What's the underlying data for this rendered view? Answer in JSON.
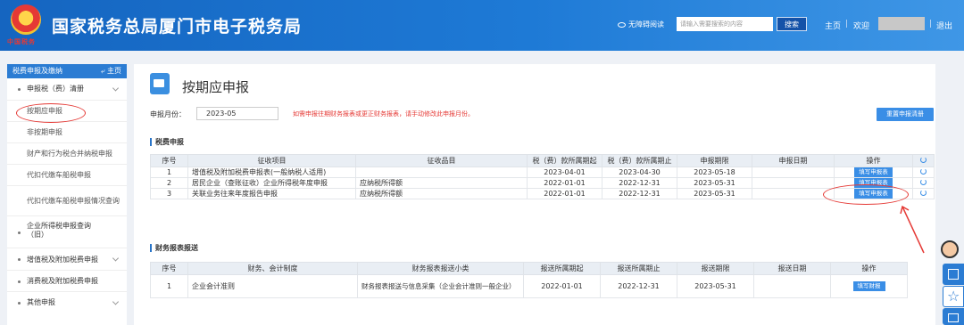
{
  "header": {
    "seal_text": "中国税务",
    "title": "国家税务总局厦门市电子税务局",
    "accessibility": "无障碍阅读",
    "search_placeholder": "请输入需要搜索的内容",
    "search_button": "搜索",
    "home": "主页",
    "welcome": "欢迎",
    "logout": "退出",
    "brand_color": "#1e7ad6"
  },
  "sidebar": {
    "title": "税费申报及缴纳",
    "home": "主页",
    "groups": [
      {
        "label": "申报税（费）清册"
      },
      {
        "label": "企业所得税申报查询（旧）"
      },
      {
        "label": "增值税及附加税费申报"
      },
      {
        "label": "消费税及附加税费申报"
      },
      {
        "label": "其他申报"
      }
    ],
    "items": [
      {
        "label": "按期应申报"
      },
      {
        "label": "非按期申报"
      },
      {
        "label": "财产和行为税合并纳税申报"
      },
      {
        "label": "代扣代缴车船税申报"
      },
      {
        "label": "代扣代缴车船税申报情况查询"
      }
    ]
  },
  "main": {
    "title": "按期应申报",
    "month_label": "申报月份：",
    "month_value": "2023-05",
    "warning": "如需申报往期财务报表或更正财务报表，请手动修改此申报月份。",
    "reset_button": "重置申报清册",
    "tax_section": "税费申报",
    "tax_headers": [
      "序号",
      "征收项目",
      "征收品目",
      "税（费）款所属期起",
      "税（费）款所属期止",
      "申报期限",
      "申报日期",
      "操作"
    ],
    "tax_rows": [
      {
        "no": "1",
        "item": "增值税及附加税费申报表(一般纳税人适用)",
        "subitem": "",
        "start": "2023-04-01",
        "end": "2023-04-30",
        "deadline": "2023-05-18",
        "date": "",
        "action": "填写申报表"
      },
      {
        "no": "2",
        "item": "居民企业（查账征收）企业所得税年度申报",
        "subitem": "应纳税所得额",
        "start": "2022-01-01",
        "end": "2022-12-31",
        "deadline": "2023-05-31",
        "date": "",
        "action": "填写申报表"
      },
      {
        "no": "3",
        "item": "关联业务往来年度报告申报",
        "subitem": "应纳税所得额",
        "start": "2022-01-01",
        "end": "2022-12-31",
        "deadline": "2023-05-31",
        "date": "",
        "action": "填写申报表"
      }
    ],
    "fin_section": "财务报表报送",
    "fin_headers": [
      "序号",
      "财务、会计制度",
      "财务报表报送小类",
      "报送所属期起",
      "报送所属期止",
      "报送期限",
      "报送日期",
      "操作"
    ],
    "fin_rows": [
      {
        "no": "1",
        "system": "企业会计准则",
        "subclass": "财务报表报送与信息采集（企业会计准则一般企业）",
        "start": "2022-01-01",
        "end": "2022-12-31",
        "deadline": "2023-05-31",
        "date": "",
        "action": "填写财报"
      }
    ]
  },
  "annotation_color": "#e53935"
}
